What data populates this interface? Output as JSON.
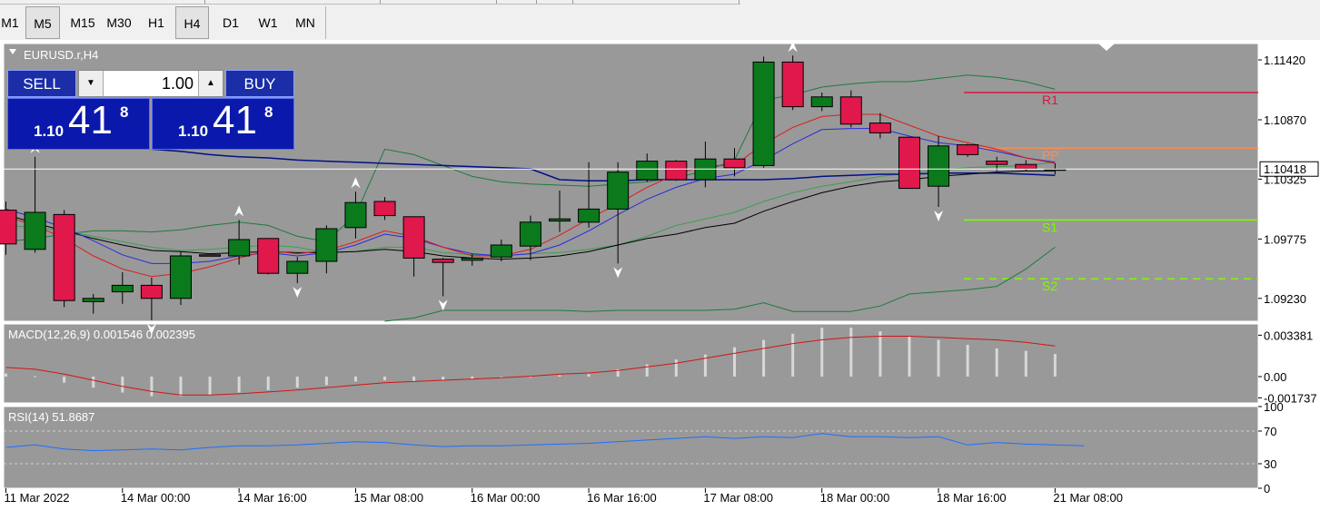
{
  "toolbar": {
    "timeframes": [
      {
        "label": "M1",
        "active": false
      },
      {
        "label": "M5",
        "active": true
      },
      {
        "label": "M15",
        "active": false
      },
      {
        "label": "M30",
        "active": false
      },
      {
        "label": "H1",
        "active": false
      },
      {
        "label": "H4",
        "active": true
      },
      {
        "label": "D1",
        "active": false
      },
      {
        "label": "W1",
        "active": false
      },
      {
        "label": "MN",
        "active": false
      }
    ]
  },
  "trade_panel": {
    "sell_label": "SELL",
    "buy_label": "BUY",
    "lot": "1.00",
    "sell_price": {
      "small": "1.10",
      "big": "41",
      "sup": "8"
    },
    "buy_price": {
      "small": "1.10",
      "big": "41",
      "sup": "8"
    },
    "down_icon": "triangle-down-icon",
    "up_icon": "triangle-up-icon"
  },
  "chart_data": [
    {
      "type": "candlestick",
      "title": "EURUSD.r,H4",
      "symbol_icon": "triangle-down-icon",
      "ylim": [
        1.0902,
        1.1157
      ],
      "y_ticks": [
        "1.11420",
        "1.10870",
        "1.10325",
        "1.09775",
        "1.09230"
      ],
      "current_price_label": "1.10418",
      "current_price": 1.10418,
      "pivot_levels": [
        {
          "label": "R1",
          "value": 1.1112,
          "color": "#dc143c",
          "style": "solid"
        },
        {
          "label": "PP",
          "value": 1.1061,
          "color": "#ff8c50",
          "style": "solid"
        },
        {
          "label": "S1",
          "value": 1.0995,
          "color": "#7cfc00",
          "style": "solid"
        },
        {
          "label": "S2",
          "value": 1.0941,
          "color": "#7cfc00",
          "style": "dashed"
        }
      ],
      "candles": [
        {
          "o": 1.1004,
          "h": 1.1012,
          "l": 1.0963,
          "c": 1.0973
        },
        {
          "o": 1.0968,
          "h": 1.1053,
          "l": 1.0965,
          "c": 1.1002
        },
        {
          "o": 1.1,
          "h": 1.1004,
          "l": 1.0915,
          "c": 1.0921
        },
        {
          "o": 1.092,
          "h": 1.0927,
          "l": 1.0909,
          "c": 1.0923
        },
        {
          "o": 1.0929,
          "h": 1.0947,
          "l": 1.0918,
          "c": 1.0935
        },
        {
          "o": 1.0935,
          "h": 1.0942,
          "l": 1.0903,
          "c": 1.0923
        },
        {
          "o": 1.0923,
          "h": 1.0966,
          "l": 1.0917,
          "c": 1.0962
        },
        {
          "o": 1.0962,
          "h": 1.0961,
          "l": 1.0961,
          "c": 1.0963
        },
        {
          "o": 1.0962,
          "h": 1.0995,
          "l": 1.0954,
          "c": 1.0977
        },
        {
          "o": 1.0978,
          "h": 1.0978,
          "l": 1.0945,
          "c": 1.0946
        },
        {
          "o": 1.0946,
          "h": 1.0961,
          "l": 1.0937,
          "c": 1.0957
        },
        {
          "o": 1.0957,
          "h": 1.099,
          "l": 1.0946,
          "c": 1.0987
        },
        {
          "o": 1.0988,
          "h": 1.1021,
          "l": 1.0978,
          "c": 1.1011
        },
        {
          "o": 1.1012,
          "h": 1.1016,
          "l": 1.0995,
          "c": 1.0999
        },
        {
          "o": 1.0998,
          "h": 1.0998,
          "l": 1.0943,
          "c": 1.096
        },
        {
          "o": 1.0959,
          "h": 1.096,
          "l": 1.0925,
          "c": 1.0956
        },
        {
          "o": 1.0958,
          "h": 1.0964,
          "l": 1.0953,
          "c": 1.096
        },
        {
          "o": 1.0961,
          "h": 1.0977,
          "l": 1.0957,
          "c": 1.0972
        },
        {
          "o": 1.0971,
          "h": 1.0999,
          "l": 1.0958,
          "c": 1.0993
        },
        {
          "o": 1.0994,
          "h": 1.1022,
          "l": 1.0984,
          "c": 1.0996
        },
        {
          "o": 1.0993,
          "h": 1.1048,
          "l": 1.0988,
          "c": 1.1005
        },
        {
          "o": 1.1005,
          "h": 1.1048,
          "l": 1.0955,
          "c": 1.1039
        },
        {
          "o": 1.1032,
          "h": 1.1056,
          "l": 1.103,
          "c": 1.1049
        },
        {
          "o": 1.1049,
          "h": 1.105,
          "l": 1.1031,
          "c": 1.1032
        },
        {
          "o": 1.1032,
          "h": 1.1067,
          "l": 1.1025,
          "c": 1.1051
        },
        {
          "o": 1.1051,
          "h": 1.1061,
          "l": 1.1035,
          "c": 1.1043
        },
        {
          "o": 1.1045,
          "h": 1.1145,
          "l": 1.1043,
          "c": 1.114
        },
        {
          "o": 1.114,
          "h": 1.1146,
          "l": 1.1096,
          "c": 1.1099
        },
        {
          "o": 1.1099,
          "h": 1.1112,
          "l": 1.1095,
          "c": 1.1108
        },
        {
          "o": 1.1108,
          "h": 1.1114,
          "l": 1.108,
          "c": 1.1083
        },
        {
          "o": 1.1084,
          "h": 1.1093,
          "l": 1.107,
          "c": 1.1075
        },
        {
          "o": 1.1071,
          "h": 1.1071,
          "l": 1.1024,
          "c": 1.1024
        },
        {
          "o": 1.1026,
          "h": 1.1072,
          "l": 1.1007,
          "c": 1.1063
        },
        {
          "o": 1.1064,
          "h": 1.1065,
          "l": 1.1053,
          "c": 1.1055
        },
        {
          "o": 1.1049,
          "h": 1.1053,
          "l": 1.104,
          "c": 1.1046
        },
        {
          "o": 1.1046,
          "h": 1.105,
          "l": 1.104,
          "c": 1.1042
        },
        {
          "o": 1.1041,
          "h": 1.1047,
          "l": 1.1037,
          "c": 1.10418
        }
      ],
      "fractals": [
        {
          "bar": 1,
          "dir": "up"
        },
        {
          "bar": 5,
          "dir": "down"
        },
        {
          "bar": 8,
          "dir": "up"
        },
        {
          "bar": 10,
          "dir": "down"
        },
        {
          "bar": 12,
          "dir": "up"
        },
        {
          "bar": 15,
          "dir": "down"
        },
        {
          "bar": 21,
          "dir": "down"
        },
        {
          "bar": 27,
          "dir": "up"
        },
        {
          "bar": 32,
          "dir": "down"
        }
      ],
      "overlays": [
        {
          "name": "bb-upper",
          "color": "#1f7a3e",
          "width": 1,
          "values": [
            1.0975,
            1.0978,
            1.0982,
            1.0985,
            1.0985,
            1.0984,
            1.0986,
            1.099,
            1.0993,
            1.099,
            1.098,
            1.0975,
            1.1,
            1.106,
            1.1055,
            1.1045,
            1.1035,
            1.103,
            1.1028,
            1.1027,
            1.1026,
            1.1028,
            1.103,
            1.1034,
            1.104,
            1.105,
            1.1105,
            1.111,
            1.1117,
            1.112,
            1.1122,
            1.1122,
            1.1125,
            1.1128,
            1.1126,
            1.1122,
            1.1115
          ]
        },
        {
          "name": "bb-lower",
          "color": "#1f7a3e",
          "width": 1,
          "values": [
            null,
            null,
            null,
            null,
            null,
            null,
            null,
            null,
            null,
            null,
            null,
            null,
            null,
            1.0902,
            1.0905,
            1.0912,
            1.0912,
            1.0912,
            1.0912,
            1.0912,
            1.0911,
            1.0912,
            1.0912,
            1.0912,
            1.0912,
            1.0913,
            1.0919,
            1.0911,
            1.0911,
            1.0911,
            1.0916,
            1.0927,
            1.0929,
            1.0931,
            1.0934,
            1.095,
            1.097
          ]
        },
        {
          "name": "bb-middle",
          "color": "#3e9e4e",
          "width": 1,
          "values": [
            1.099,
            1.0988,
            1.0985,
            1.098,
            1.0975,
            1.097,
            1.0967,
            1.0968,
            1.097,
            1.0972,
            1.097,
            1.0965,
            1.0966,
            1.097,
            1.097,
            1.0965,
            1.0963,
            1.0962,
            1.0964,
            1.0965,
            1.0968,
            1.0972,
            1.098,
            1.099,
            1.0996,
            1.1002,
            1.1012,
            1.102,
            1.1026,
            1.103,
            1.1035,
            1.1038,
            1.1041,
            1.1043,
            1.1044,
            1.1045,
            1.1048
          ]
        },
        {
          "name": "ma-long-navy",
          "color": "#00108a",
          "width": 1.5,
          "values": [
            null,
            null,
            null,
            null,
            null,
            1.106,
            1.1058,
            1.1055,
            1.1053,
            1.1052,
            1.105,
            1.1049,
            1.1048,
            1.1047,
            1.1046,
            1.1045,
            1.1044,
            1.1043,
            1.1042,
            1.1032,
            1.1031,
            1.1031,
            1.1032,
            1.1032,
            1.1032,
            1.1032,
            1.1032,
            1.1033,
            1.1035,
            1.1036,
            1.1037,
            1.1037,
            1.1038,
            1.1038,
            1.1038,
            1.1037,
            1.1036
          ]
        },
        {
          "name": "ma-black",
          "color": "#000000",
          "width": 1,
          "values": [
            1.1,
            1.0992,
            1.0985,
            1.0978,
            1.0972,
            1.0967,
            1.0966,
            1.0964,
            1.0965,
            1.0966,
            1.0965,
            1.0965,
            1.0966,
            1.0968,
            1.0966,
            1.0962,
            1.096,
            1.0959,
            1.096,
            1.0962,
            1.0966,
            1.0972,
            1.0978,
            1.0982,
            1.0988,
            1.0992,
            1.1003,
            1.1012,
            1.102,
            1.1026,
            1.103,
            1.1032,
            1.1035,
            1.1037,
            1.1039,
            1.104,
            1.104
          ]
        },
        {
          "name": "ma-blue",
          "color": "#2a2ae0",
          "width": 1,
          "values": [
            1.1005,
            1.0997,
            1.0988,
            1.0976,
            1.0963,
            1.0955,
            1.0955,
            1.0957,
            1.0962,
            1.0965,
            1.0962,
            1.0965,
            1.0972,
            1.0982,
            1.0978,
            1.097,
            1.0964,
            1.0962,
            1.0964,
            1.0972,
            1.0985,
            1.1,
            1.1014,
            1.1025,
            1.1033,
            1.1037,
            1.105,
            1.1065,
            1.1078,
            1.1079,
            1.1079,
            1.1072,
            1.1066,
            1.1063,
            1.1058,
            1.1052,
            1.1048
          ]
        },
        {
          "name": "ma-red",
          "color": "#e01b1b",
          "width": 1,
          "values": [
            1.0998,
            1.099,
            1.0978,
            1.0962,
            1.095,
            1.0943,
            1.0946,
            1.0952,
            1.096,
            1.0967,
            1.0964,
            1.0967,
            1.0975,
            1.0985,
            1.098,
            1.097,
            1.0962,
            1.0962,
            1.0968,
            1.0981,
            1.0996,
            1.101,
            1.1025,
            1.1037,
            1.1045,
            1.1045,
            1.1065,
            1.108,
            1.109,
            1.1092,
            1.1092,
            1.1082,
            1.1072,
            1.1066,
            1.106,
            1.1052,
            1.1047
          ]
        }
      ]
    },
    {
      "type": "bar",
      "title": "MACD(12,26,9) 0.001546 0.002395",
      "ylim": [
        -0.00215,
        0.0043
      ],
      "y_ticks": [
        {
          "label": "0.003381",
          "value": 0.003381
        },
        {
          "label": "0.00",
          "value": 0.0
        },
        {
          "label": "-0.001737",
          "value": -0.001737
        }
      ],
      "histogram": [
        0.00025,
        3e-05,
        -0.0005,
        -0.0009,
        -0.0013,
        -0.0016,
        -0.0016,
        -0.0015,
        -0.0013,
        -0.0011,
        -0.0009,
        -0.0007,
        -0.0004,
        -0.0003,
        -0.0004,
        -0.0003,
        -0.0002,
        -0.0001,
        1e-05,
        0.0001,
        0.0002,
        0.0006,
        0.001,
        0.0014,
        0.0018,
        0.0024,
        0.003,
        0.0035,
        0.004,
        0.004,
        0.0037,
        0.0033,
        0.003,
        0.0026,
        0.0023,
        0.0021,
        0.00185
      ],
      "signal": [
        0.00075,
        0.0006,
        0.0002,
        -0.0003,
        -0.0008,
        -0.0012,
        -0.0015,
        -0.0015,
        -0.0014,
        -0.00125,
        -0.0011,
        -0.0009,
        -0.0007,
        -0.0005,
        -0.0004,
        -0.0003,
        -0.0002,
        -0.0001,
        3e-05,
        0.0002,
        0.0003,
        0.0005,
        0.0008,
        0.0011,
        0.0015,
        0.0019,
        0.0023,
        0.0027,
        0.003,
        0.0032,
        0.0033,
        0.0033,
        0.0032,
        0.0031,
        0.003,
        0.0028,
        0.0025
      ]
    },
    {
      "type": "line",
      "title": "RSI(14) 51.8687",
      "ylim": [
        0,
        100
      ],
      "y_ticks": [
        {
          "label": "100",
          "value": 100
        },
        {
          "label": "70",
          "value": 70
        },
        {
          "label": "30",
          "value": 30
        },
        {
          "label": "0",
          "value": 0
        }
      ],
      "levels": [
        70,
        30
      ],
      "values": [
        50,
        53,
        48,
        46,
        47,
        48,
        47,
        50,
        52,
        52,
        53,
        55,
        57,
        56,
        53,
        51,
        52,
        52,
        53,
        54,
        55,
        57,
        59,
        61,
        63,
        61,
        63,
        62,
        67,
        63,
        63,
        62,
        63,
        53,
        56,
        54,
        53,
        52
      ]
    }
  ],
  "x_labels": [
    {
      "label": "11 Mar 2022",
      "bar": 0
    },
    {
      "label": "14 Mar 00:00",
      "bar": 4
    },
    {
      "label": "14 Mar 16:00",
      "bar": 8
    },
    {
      "label": "15 Mar 08:00",
      "bar": 12
    },
    {
      "label": "16 Mar 00:00",
      "bar": 16
    },
    {
      "label": "16 Mar 16:00",
      "bar": 20
    },
    {
      "label": "17 Mar 08:00",
      "bar": 24
    },
    {
      "label": "18 Mar 00:00",
      "bar": 28
    },
    {
      "label": "18 Mar 16:00",
      "bar": 32
    },
    {
      "label": "21 Mar 08:00",
      "bar": 36
    }
  ],
  "colors": {
    "panel_bg": "#999999",
    "bull": "#0a7a1d",
    "bear": "#e0184b",
    "axis_text": "#000000",
    "label_text": "#ffffff",
    "macd_hist": "#d8d8d8",
    "macd_signal": "#d11515",
    "rsi_line": "#1e6fff"
  }
}
